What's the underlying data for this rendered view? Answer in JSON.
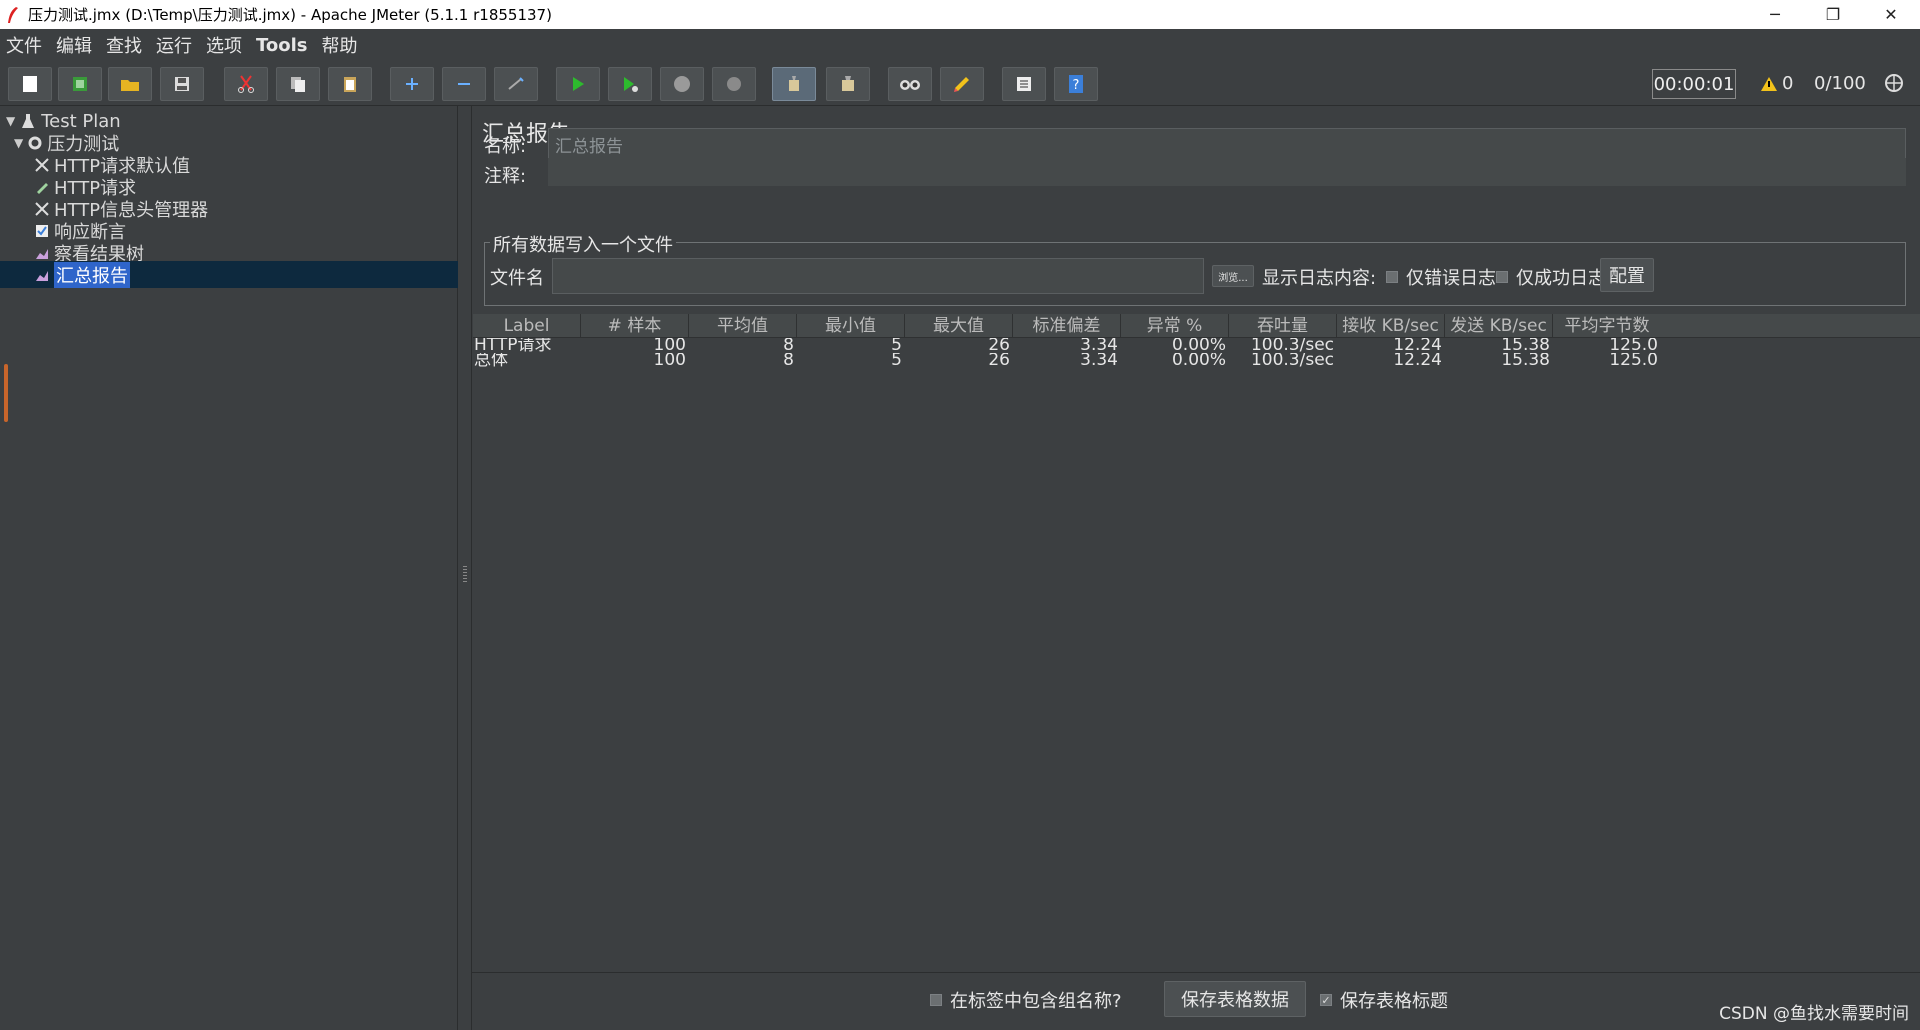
{
  "window": {
    "title": "压力测试.jmx (D:\\Temp\\压力测试.jmx) - Apache JMeter (5.1.1 r1855137)",
    "minimize": "─",
    "restore": "❐",
    "close": "✕"
  },
  "menu": [
    "文件",
    "编辑",
    "查找",
    "运行",
    "选项",
    "Tools",
    "帮助"
  ],
  "status": {
    "elapsed": "00:00:01",
    "warnings": "0",
    "threads": "0/100"
  },
  "tree": {
    "root": "Test Plan",
    "group": "压力测试",
    "items": [
      "HTTP请求默认值",
      "HTTP请求",
      "HTTP信息头管理器",
      "响应断言",
      "察看结果树",
      "汇总报告"
    ]
  },
  "panel": {
    "title": "汇总报告",
    "name_label": "名称:",
    "name_value": "汇总报告",
    "comment_label": "注释:",
    "comment_value": "",
    "fieldset_legend": "所有数据写入一个文件",
    "filename_label": "文件名",
    "filename_value": "",
    "browse_label": "浏览...",
    "log_content_label": "显示日志内容:",
    "errors_only": "仅错误日志",
    "success_only": "仅成功日志",
    "configure": "配置"
  },
  "table": {
    "headers": [
      "Label",
      "# 样本",
      "平均值",
      "最小值",
      "最大值",
      "标准偏差",
      "异常 %",
      "吞吐量",
      "接收 KB/sec",
      "发送 KB/sec",
      "平均字节数"
    ],
    "rows": [
      [
        "HTTP请求",
        "100",
        "8",
        "5",
        "26",
        "3.34",
        "0.00%",
        "100.3/sec",
        "12.24",
        "15.38",
        "125.0"
      ],
      [
        "总体",
        "100",
        "8",
        "5",
        "26",
        "3.34",
        "0.00%",
        "100.3/sec",
        "12.24",
        "15.38",
        "125.0"
      ]
    ]
  },
  "bottom": {
    "include_group": "在标签中包含组名称?",
    "save_table": "保存表格数据",
    "save_header": "保存表格标题"
  },
  "watermark": "CSDN @鱼找水需要时间",
  "colors": {
    "background": "#3c3f41",
    "selection": "#2f65ca",
    "text": "#e6e6e6"
  }
}
